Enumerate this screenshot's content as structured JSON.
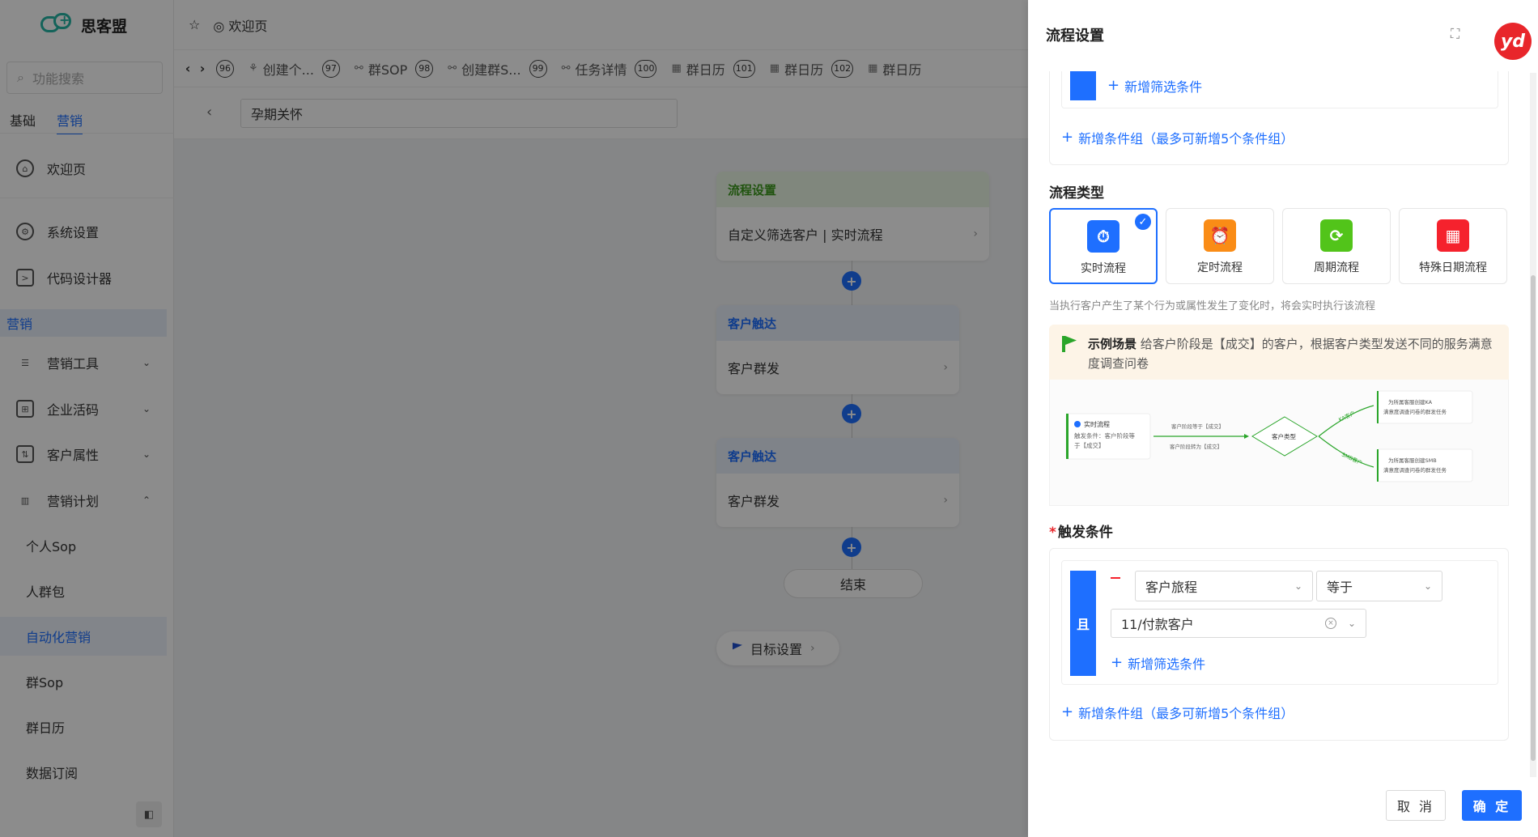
{
  "app": {
    "brand": "思客盟",
    "search_placeholder": "功能搜索",
    "side_tabs": [
      "基础",
      "营销"
    ],
    "menu": {
      "welcome": "欢迎页",
      "system_settings": "系统设置",
      "code_designer": "代码设计器",
      "group_marketing": "营销",
      "marketing_tools": "营销工具",
      "enterprise_live_code": "企业活码",
      "customer_attrs": "客户属性",
      "marketing_plan": "营销计划",
      "personal_sop": "个人Sop",
      "crowd_pack": "人群包",
      "auto_marketing": "自动化营销",
      "group_sop": "群Sop",
      "group_calendar": "群日历",
      "data_subscribe": "数据订阅"
    },
    "topbar_welcome": "欢迎页",
    "tabs": [
      {
        "num": "96",
        "label": "创建个..."
      },
      {
        "num": "97",
        "label": "群SOP"
      },
      {
        "num": "98",
        "label": "创建群S..."
      },
      {
        "num": "99",
        "label": "任务详情"
      },
      {
        "num": "100",
        "label": "群日历"
      },
      {
        "num": "101",
        "label": "群日历"
      },
      {
        "num": "102",
        "label": "群日历"
      }
    ],
    "flow_name": "孕期关怀"
  },
  "flow": {
    "node1_head": "流程设置",
    "node1_body": "自定义筛选客户 | 实时流程",
    "node2_head": "客户触达",
    "node2_body": "客户群发",
    "node3_head": "客户触达",
    "node3_body": "客户群发",
    "end": "结束",
    "goal": "目标设置"
  },
  "drawer": {
    "title": "流程设置",
    "avatar": "yd",
    "add_filter": "新增筛选条件",
    "add_group": "新增条件组（最多可新增5个条件组）",
    "flow_type_label": "流程类型",
    "flow_types": [
      {
        "label": "实时流程",
        "color": "#1e6fff",
        "icon": "stopwatch-icon"
      },
      {
        "label": "定时流程",
        "color": "#fa8c16",
        "icon": "alarm-clock-icon"
      },
      {
        "label": "周期流程",
        "color": "#52c41a",
        "icon": "cycle-icon"
      },
      {
        "label": "特殊日期流程",
        "color": "#f5222d",
        "icon": "calendar-icon"
      }
    ],
    "flow_type_desc": "当执行客户产生了某个行为或属性发生了变化时，将会实时执行该流程",
    "scenario_title": "示例场景",
    "scenario_text": "给客户阶段是【成交】的客户，根据客户类型发送不同的服务满意度调查问卷",
    "diagram": {
      "start_title": "实时流程",
      "start_desc1": "触发条件：客户阶段等",
      "start_desc2": "于【成交】",
      "edge_top": "客户阶段等于【成交】",
      "edge_bottom": "客户阶段转为【成交】",
      "decision": "客户类型",
      "branch_a": "KA客户",
      "branch_b": "SMB客户",
      "result_a1": "为所属客服创建KA",
      "result_a2": "满意度调查问卷的群发任务",
      "result_b1": "为所属客服创建SMB",
      "result_b2": "满意度调查问卷的群发任务"
    },
    "trigger_label": "触发条件",
    "and_label": "且",
    "field_select": "客户旅程",
    "operator_select": "等于",
    "value_select": "11/付款客户",
    "cancel": "取 消",
    "confirm": "确 定"
  }
}
